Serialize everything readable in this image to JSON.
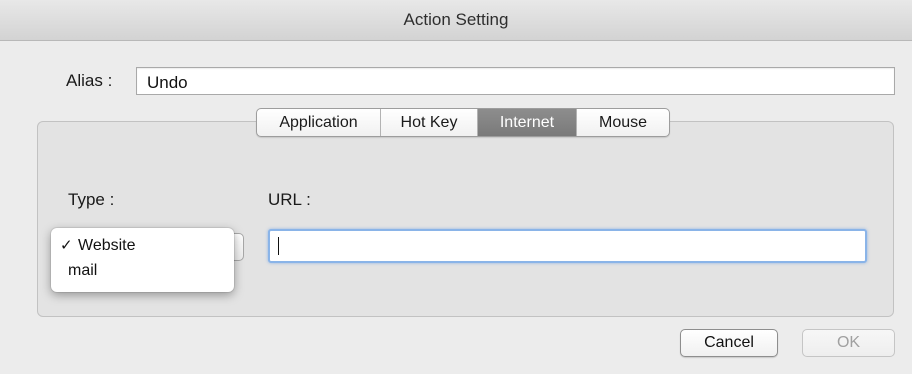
{
  "window": {
    "title": "Action Setting"
  },
  "alias": {
    "label": "Alias :",
    "value": "Undo"
  },
  "tabs": [
    {
      "label": "Application",
      "active": false
    },
    {
      "label": "Hot Key",
      "active": false
    },
    {
      "label": "Internet",
      "active": true
    },
    {
      "label": "Mouse",
      "active": false
    }
  ],
  "internet": {
    "type_label": "Type :",
    "url_label": "URL :",
    "url_value": "",
    "type_options": [
      {
        "label": "Website",
        "checked": true,
        "check_mark": "✓"
      },
      {
        "label": "mail",
        "checked": false,
        "check_mark": ""
      }
    ]
  },
  "buttons": {
    "cancel": "Cancel",
    "ok": "OK"
  }
}
